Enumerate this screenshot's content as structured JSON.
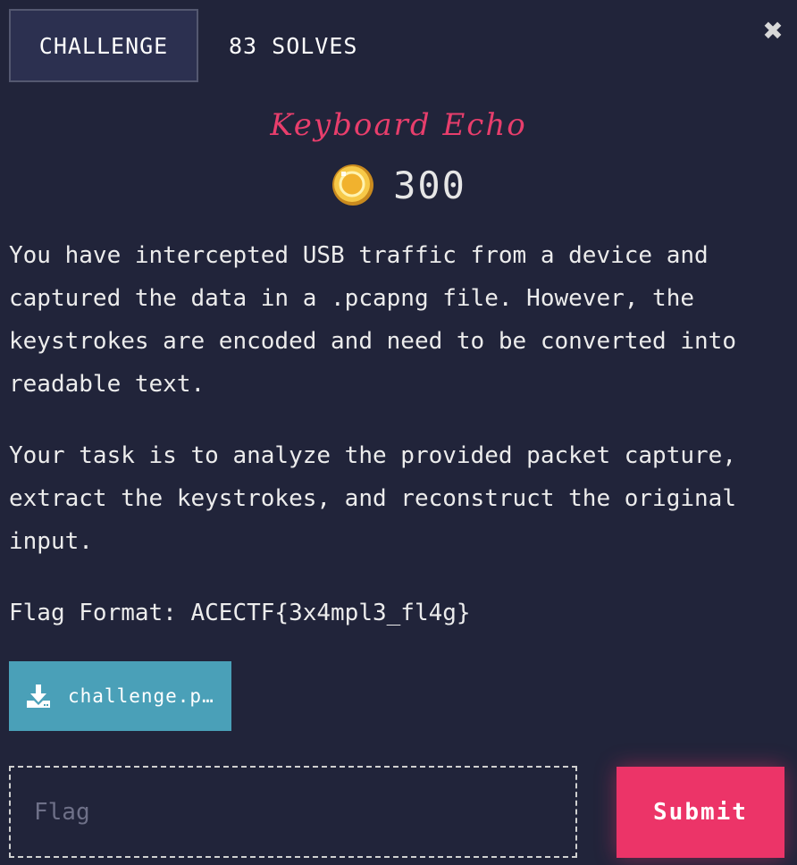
{
  "tabs": [
    {
      "label": "CHALLENGE",
      "active": true
    },
    {
      "label": "83 SOLVES",
      "active": false
    }
  ],
  "close_icon": "close-icon",
  "challenge": {
    "title": "Keyboard Echo",
    "points": "300",
    "points_icon": "coin-icon",
    "description": [
      "You have intercepted USB traffic from a device and captured the data in a .pcapng file. However, the keystrokes are encoded and need to be converted into readable text.",
      "Your task is to analyze the provided packet capture, extract the keystrokes, and reconstruct the original input.",
      "Flag Format: ACECTF{3x4mpl3_fl4g}"
    ],
    "file": {
      "label": "challenge.p…",
      "icon": "download-icon"
    }
  },
  "flag_form": {
    "placeholder": "Flag",
    "value": "",
    "submit_label": "Submit"
  },
  "colors": {
    "background": "#21243a",
    "title": "#e83e6c",
    "download_button": "#4aa0b8",
    "submit_button": "#ec3468"
  }
}
